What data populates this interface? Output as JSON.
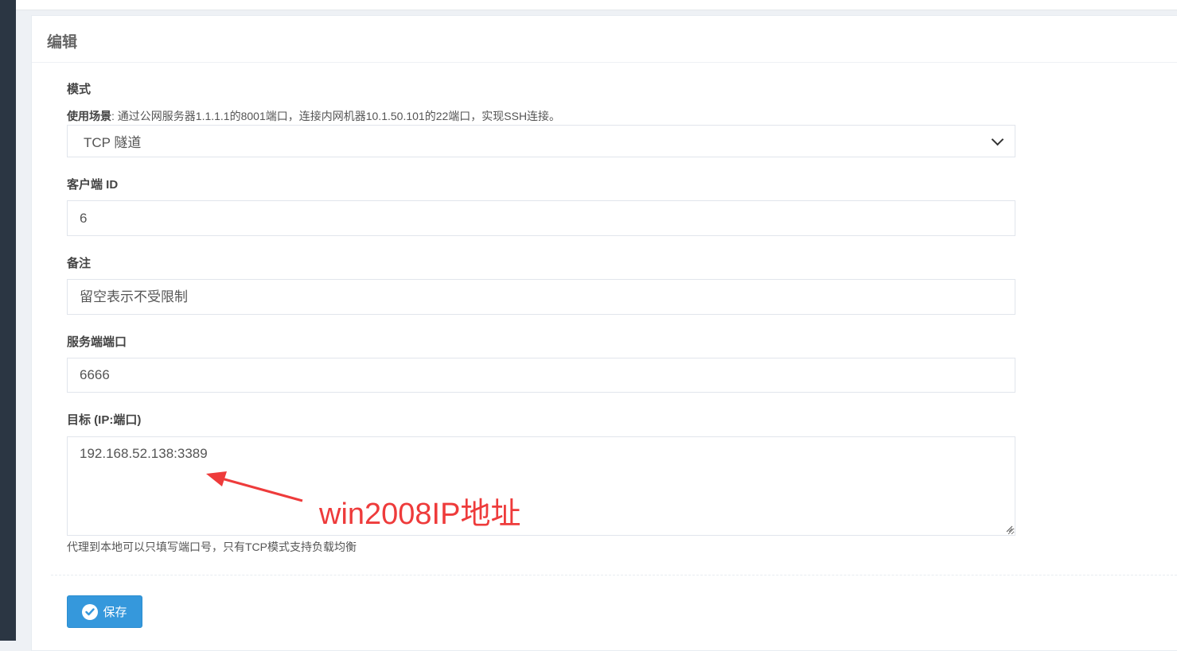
{
  "panel": {
    "title": "编辑"
  },
  "form": {
    "mode": {
      "label": "模式",
      "usage_label": "使用场景",
      "usage_text": ": 通过公网服务器1.1.1.1的8001端口，连接内网机器10.1.50.101的22端口，实现SSH连接。",
      "selected": "TCP 隧道"
    },
    "client_id": {
      "label": "客户端 ID",
      "value": "6"
    },
    "remark": {
      "label": "备注",
      "placeholder": "留空表示不受限制"
    },
    "server_port": {
      "label": "服务端端口",
      "value": "6666"
    },
    "target": {
      "label": "目标 (IP:端口)",
      "value": "192.168.52.138:3389",
      "help": "代理到本地可以只填写端口号，只有TCP模式支持负载均衡"
    },
    "save_label": "保存"
  },
  "annotation": {
    "text": "win2008IP地址",
    "color": "#ee3b3b"
  },
  "colors": {
    "sidebar": "#2b3643",
    "primary_button": "#3598dc"
  }
}
